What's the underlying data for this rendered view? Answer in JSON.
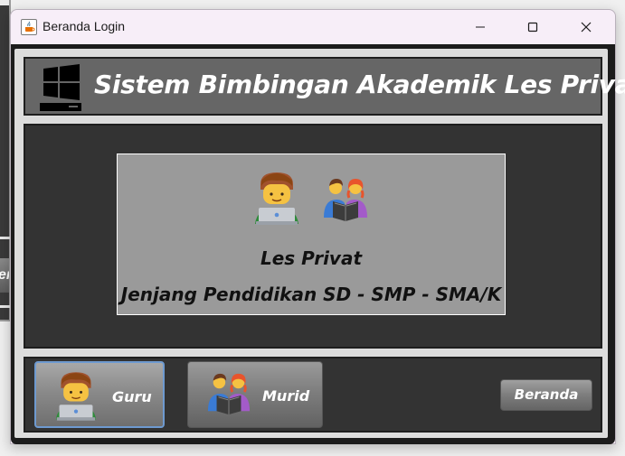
{
  "window": {
    "title": "Beranda Login"
  },
  "background_window": {
    "button_fragment": "er"
  },
  "header": {
    "heading": "Sistem Bimbingan Akademik Les Privat"
  },
  "card": {
    "line1": "Les Privat",
    "line2": "Jenjang Pendidikan SD - SMP - SMA/K"
  },
  "nav": {
    "guru_label": "Guru",
    "murid_label": "Murid",
    "beranda_label": "Beranda"
  },
  "icons": {
    "app": "java-icon",
    "header": "computer-icon",
    "teacher": "teacher-laptop-icon",
    "students": "students-reading-icon"
  },
  "colors": {
    "header_bg": "#666666",
    "panel_bg": "#333333",
    "card_bg": "#9a9a9a",
    "focus_border": "#6e9ad0"
  }
}
